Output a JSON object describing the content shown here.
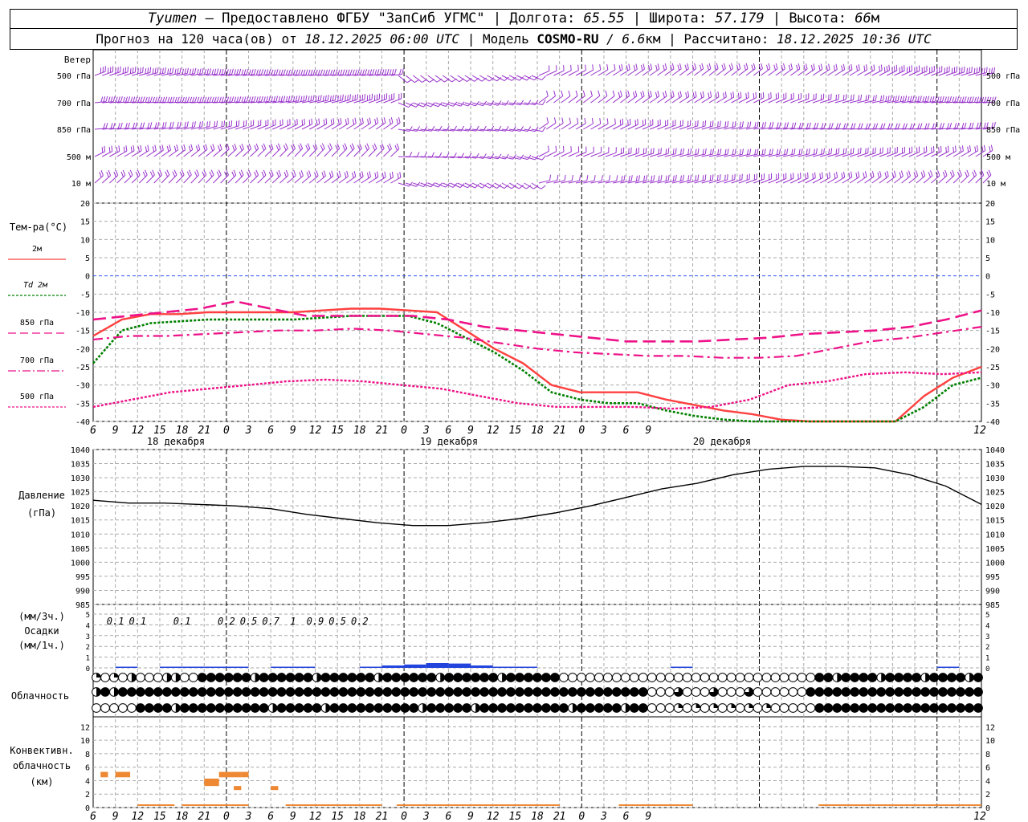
{
  "header": {
    "city": "Tyumen",
    "provider": " – Предоставлено ФГБУ \"ЗапСиб УГМС\" | Долгота: ",
    "lon": "65.55",
    "lat_label": " | Широта: ",
    "lat": "57.179",
    "alt_label": " | Высота: ",
    "alt": "66",
    "alt_unit": "м",
    "forecast_label": "Прогноз на 120 часа(ов) от ",
    "forecast_from": "18.12.2025 06:00 UTC",
    "model_label": " | Модель ",
    "model": "COSMO-RU",
    "res_sep": " / ",
    "res": "6.6",
    "res_unit": "км",
    "calc_label": " | Рассчитано: ",
    "calc": "18.12.2025 10:36 UTC"
  },
  "hour_ticks": [
    "6",
    "9",
    "12",
    "15",
    "18",
    "21",
    "0",
    "3",
    "6",
    "9",
    "12",
    "15",
    "18",
    "21",
    "0",
    "3",
    "6",
    "9",
    "12",
    "15",
    "18",
    "21",
    "0",
    "3",
    "6",
    "9",
    "12"
  ],
  "day_labels": [
    "18 декабря",
    "19 декабря",
    "20 декабря"
  ],
  "wind": {
    "title": "Ветер",
    "levels": [
      "500 гПа",
      "700 гПа",
      "850 гПа",
      "500 м",
      "10  м"
    ],
    "color": "#9933cc"
  },
  "temp": {
    "title": "Тем-ра(°С)",
    "legend": [
      {
        "label": "2м",
        "color": "#ff4040"
      },
      {
        "label": "Td  2м",
        "color": "#008000"
      },
      {
        "label": "850 гПа",
        "color": "#ee1188"
      },
      {
        "label": "700 гПа",
        "color": "#ee1188"
      },
      {
        "label": "500 гПа",
        "color": "#ee1188"
      }
    ],
    "ticks": [
      "20",
      "15",
      "10",
      "5",
      "0",
      "-5",
      "-10",
      "-15",
      "-20",
      "-25",
      "-30",
      "-35",
      "-40"
    ]
  },
  "pressure": {
    "title": "Давление",
    "unit": "(гПа)",
    "ticks": [
      "1040",
      "1035",
      "1030",
      "1025",
      "1020",
      "1015",
      "1010",
      "1005",
      "1000",
      "995",
      "990",
      "985"
    ]
  },
  "precip": {
    "unit1": "(мм/3ч.)",
    "title": "Осадки",
    "unit2": "(мм/1ч.)",
    "ticks": [
      "5",
      "4",
      "3",
      "2",
      "1",
      "0"
    ],
    "labels": [
      {
        "h": 3,
        "text": "0.1"
      },
      {
        "h": 6,
        "text": "0.1"
      },
      {
        "h": 12,
        "text": "0.1"
      },
      {
        "h": 18,
        "text": "0.2"
      },
      {
        "h": 21,
        "text": "0.5"
      },
      {
        "h": 24,
        "text": "0.7"
      },
      {
        "h": 27,
        "text": "1"
      },
      {
        "h": 30,
        "text": "0.9"
      },
      {
        "h": 33,
        "text": "0.5"
      },
      {
        "h": 36,
        "text": "0.2"
      }
    ]
  },
  "cloud": {
    "title": "Облачность"
  },
  "conv": {
    "title1": "Конвективн.",
    "title2": "облачность",
    "unit": "(км)",
    "ticks": [
      "12",
      "10",
      "8",
      "6",
      "4",
      "2",
      "0"
    ],
    "color": "#ee8833"
  },
  "chart_data": {
    "type": "line",
    "time_start": "18.12.2025 06:00 UTC",
    "time_step_hours": 3,
    "x": [
      0,
      3,
      6,
      9,
      12,
      15,
      18,
      21,
      24,
      27,
      30,
      33,
      36,
      39,
      42,
      45,
      48,
      51,
      54,
      57,
      60,
      63,
      66,
      69,
      72,
      75,
      78
    ],
    "temperature_ylim": [
      -40,
      20
    ],
    "series": [
      {
        "name": "2м",
        "values": [
          -16.5,
          -12,
          -10.5,
          -10.5,
          -10,
          -10,
          -10,
          -10,
          -9.5,
          -9,
          -9,
          -9.5,
          -10,
          -15,
          -20,
          -24,
          -30,
          -32,
          -32,
          -32,
          -34,
          -35.5,
          -37,
          -38,
          -39.5,
          -40,
          -42,
          -44,
          -40,
          -33,
          -28,
          -25
        ]
      },
      {
        "name": "Td  2м",
        "values": [
          -24,
          -15,
          -13,
          -12.5,
          -12,
          -12,
          -12,
          -12,
          -11.5,
          -11,
          -11,
          -11,
          -13,
          -17,
          -21,
          -26,
          -32,
          -34,
          -35,
          -35,
          -37,
          -38.5,
          -39.5,
          -41,
          -42,
          -43,
          -45,
          -47,
          -42,
          -36,
          -30,
          -28
        ]
      },
      {
        "name": "850 гПа",
        "values": [
          -12,
          -11,
          -10,
          -9,
          -7,
          -9,
          -11,
          -11,
          -11,
          -11,
          -12,
          -14,
          -15,
          -16,
          -17,
          -18,
          -18,
          -18,
          -17.5,
          -17,
          -16,
          -15.5,
          -15,
          -14,
          -12,
          -9.5
        ]
      },
      {
        "name": "700 гПа",
        "values": [
          -17.5,
          -16.5,
          -16.5,
          -16,
          -15.5,
          -15,
          -15,
          -14.5,
          -15,
          -16,
          -17,
          -18.5,
          -20,
          -21,
          -21.5,
          -22,
          -22,
          -22.5,
          -22.5,
          -22,
          -20,
          -18,
          -17,
          -15.5,
          -14
        ]
      },
      {
        "name": "500 гПа",
        "values": [
          -36,
          -34,
          -32,
          -31,
          -30,
          -29,
          -28.5,
          -29,
          -30,
          -31,
          -33,
          -35,
          -36,
          -36,
          -36,
          -36.5,
          -36,
          -34,
          -30,
          -29,
          -27,
          -26.5,
          -27,
          -26.5
        ]
      }
    ],
    "pressure": {
      "ylim": [
        985,
        1040
      ],
      "values": [
        1022,
        1021,
        1021,
        1020.5,
        1020,
        1019,
        1017,
        1015.5,
        1014,
        1013,
        1013,
        1014,
        1015.5,
        1017.5,
        1020,
        1023,
        1026,
        1028,
        1031,
        1033,
        1034,
        1034,
        1033.5,
        1031,
        1027,
        1020.5
      ]
    },
    "precip_3h": [
      0,
      0.02,
      0,
      0.1,
      0.08,
      0.02,
      0.05,
      0,
      0.1,
      0.05,
      0,
      0,
      0.2,
      0.5,
      0.7,
      1,
      0.9,
      0.5,
      0.2,
      0.05,
      0,
      0,
      0,
      0,
      0,
      0,
      0.02,
      0,
      0,
      0,
      0,
      0,
      0,
      0,
      0,
      0,
      0,
      0,
      0.02,
      0,
      0
    ],
    "convective_cloud_km": [
      {
        "h0": 1,
        "h1": 2,
        "base": 4.5,
        "top": 5.3
      },
      {
        "h0": 3,
        "h1": 5,
        "base": 4.5,
        "top": 5.3
      },
      {
        "h0": 15,
        "h1": 17,
        "base": 3.2,
        "top": 4.3
      },
      {
        "h0": 17,
        "h1": 20,
        "base": 4.5,
        "top": 5.3
      },
      {
        "h0": 19,
        "h1": 20,
        "base": 2.6,
        "top": 3.2
      },
      {
        "h0": 20,
        "h1": 21,
        "base": 4.5,
        "top": 5.3
      },
      {
        "h0": 24,
        "h1": 25,
        "base": 2.6,
        "top": 3.2
      }
    ]
  }
}
